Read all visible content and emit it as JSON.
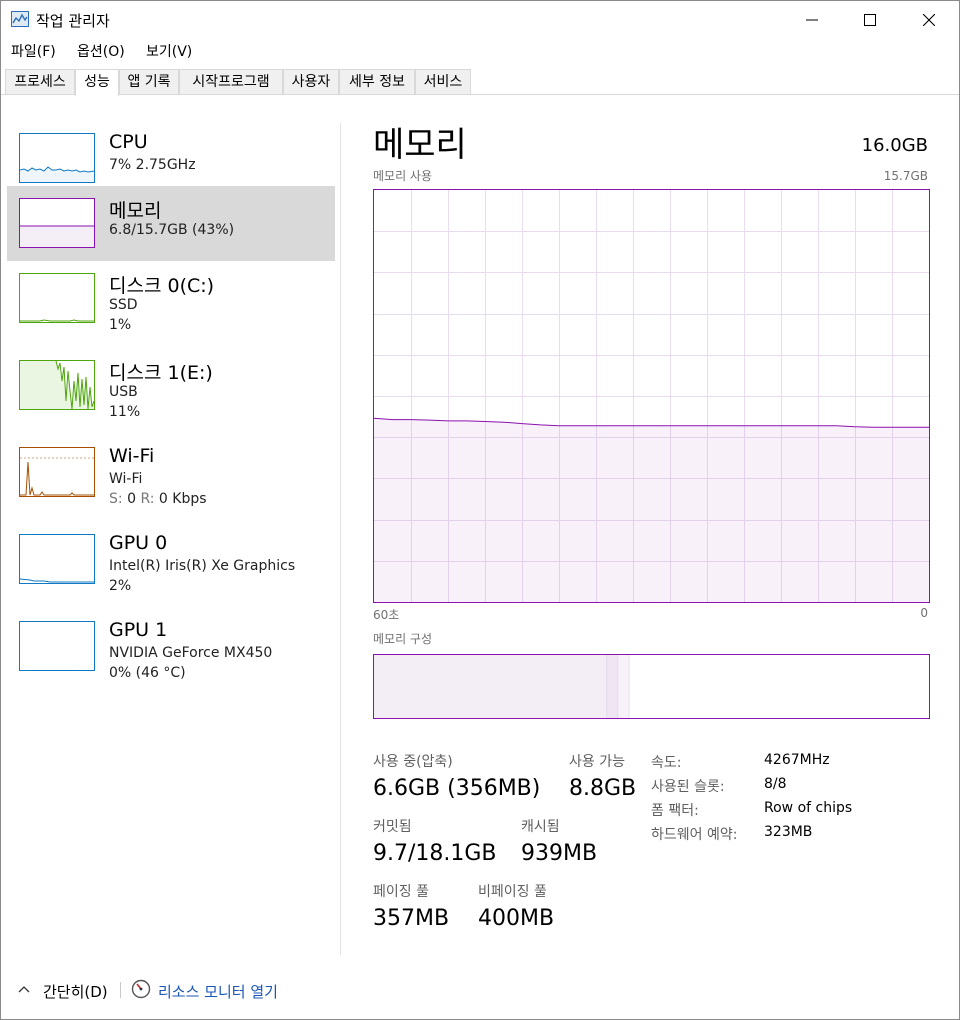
{
  "window": {
    "title": "작업 관리자",
    "minimize_icon": "minimize-icon",
    "maximize_icon": "maximize-icon",
    "close_icon": "close-icon"
  },
  "menu": [
    "파일(F)",
    "옵션(O)",
    "보기(V)"
  ],
  "tabs": [
    "프로세스",
    "성능",
    "앱 기록",
    "시작프로그램",
    "사용자",
    "세부 정보",
    "서비스"
  ],
  "active_tab": "성능",
  "sidebar": [
    {
      "title": "CPU",
      "line1": "7% 2.75GHz",
      "line2": "",
      "color": "#1179c3"
    },
    {
      "title": "메모리",
      "line1": "6.8/15.7GB (43%)",
      "line2": "",
      "color": "#8b12ae"
    },
    {
      "title": "디스크 0(C:)",
      "line1": "SSD",
      "line2": "1%",
      "color": "#4da60c"
    },
    {
      "title": "디스크 1(E:)",
      "line1": "USB",
      "line2": "11%",
      "color": "#4da60c"
    },
    {
      "title": "Wi-Fi",
      "line1": "Wi-Fi",
      "line2": "",
      "color": "#a74f01",
      "send_label": "S:",
      "send_value": "0",
      "recv_label": "R:",
      "recv_value": "0 Kbps"
    },
    {
      "title": "GPU 0",
      "line1": "Intel(R) Iris(R) Xe Graphics",
      "line2": "2%",
      "color": "#1179c3"
    },
    {
      "title": "GPU 1",
      "line1": "NVIDIA GeForce MX450",
      "line2": "0% (46 °C)",
      "color": "#1179c3"
    }
  ],
  "memory": {
    "title": "메모리",
    "total": "16.0GB",
    "usage_label": "메모리 사용",
    "usage_max": "15.7GB",
    "x_start": "60초",
    "x_end": "0",
    "composition_label": "메모리 구성",
    "stats": {
      "in_use_label": "사용 중(압축)",
      "in_use_value": "6.6GB (356MB)",
      "available_label": "사용 가능",
      "available_value": "8.8GB",
      "committed_label": "커밋됨",
      "committed_value": "9.7/18.1GB",
      "cached_label": "캐시됨",
      "cached_value": "939MB",
      "paged_label": "페이징 풀",
      "paged_value": "357MB",
      "nonpaged_label": "비페이징 풀",
      "nonpaged_value": "400MB"
    },
    "props": {
      "speed_label": "속도:",
      "speed_value": "4267MHz",
      "slots_label": "사용된 슬롯:",
      "slots_value": "8/8",
      "form_label": "폼 팩터:",
      "form_value": "Row of chips",
      "reserved_label": "하드웨어 예약:",
      "reserved_value": "323MB"
    }
  },
  "chart_data": {
    "type": "area",
    "xlabel": "",
    "ylabel": "",
    "xlim": [
      60,
      0
    ],
    "ylim": [
      0,
      15.7
    ],
    "grid": true,
    "x": [
      60,
      58,
      56,
      54,
      52,
      50,
      48,
      46,
      44,
      42,
      40,
      38,
      36,
      34,
      32,
      30,
      28,
      26,
      24,
      22,
      20,
      18,
      16,
      14,
      12,
      10,
      8,
      6,
      4,
      2,
      0
    ],
    "series": [
      {
        "values": [
          7.0,
          6.95,
          6.95,
          6.93,
          6.9,
          6.9,
          6.88,
          6.85,
          6.8,
          6.75,
          6.72,
          6.72,
          6.72,
          6.72,
          6.72,
          6.72,
          6.72,
          6.72,
          6.72,
          6.72,
          6.72,
          6.72,
          6.72,
          6.72,
          6.72,
          6.72,
          6.68,
          6.66,
          6.66,
          6.66,
          6.66
        ]
      }
    ]
  },
  "composition": {
    "segments": [
      {
        "fraction": 0.42
      },
      {
        "fraction": 0.02
      },
      {
        "fraction": 0.02
      },
      {
        "fraction": 0.56
      }
    ]
  },
  "footer": {
    "fewer_details": "간단히(D)",
    "resource_monitor": "리소스 모니터 열기"
  }
}
